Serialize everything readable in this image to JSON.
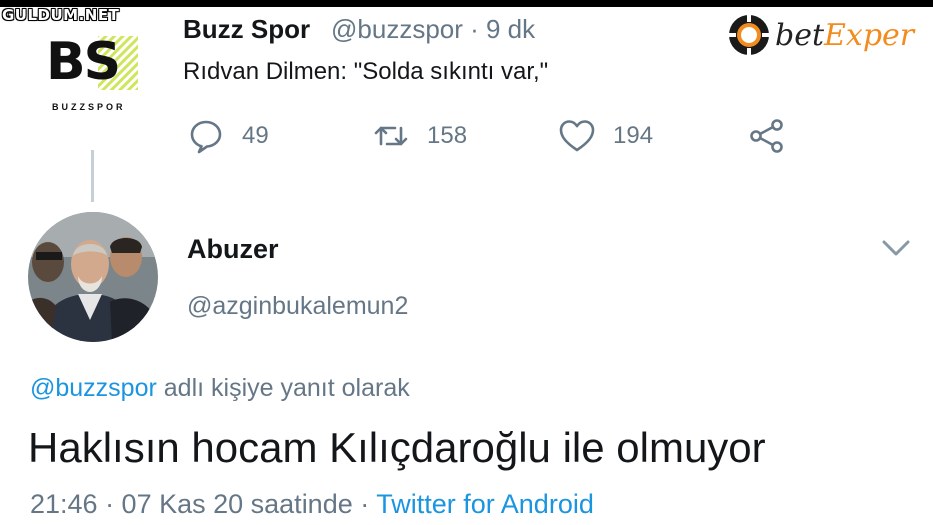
{
  "watermark": {
    "text": "GULDUM.NET"
  },
  "parent_tweet": {
    "avatar_logo": {
      "letters": "BS",
      "subtitle": "BUZZSPOR"
    },
    "name": "Buzz Spor",
    "handle_time": "@buzzspor · 9 dk",
    "text": "Rıdvan Dilmen: \"Solda sıkıntı var,\"",
    "actions": {
      "reply_count": "49",
      "retweet_count": "158",
      "like_count": "194"
    }
  },
  "ad_logo": {
    "bet": "bet",
    "exper": "Exper"
  },
  "reply_tweet": {
    "name": "Abuzer",
    "handle": "@azginbukalemun2",
    "reply_to": {
      "mention": "@buzzspor",
      "suffix": " adlı kişiye yanıt olarak"
    },
    "text": "Haklısın hocam Kılıçdaroğlu ile olmuyor",
    "meta": {
      "datetime": "21:46 · 07 Kas 20 saatinde · ",
      "source": "Twitter for Android"
    }
  },
  "colors": {
    "text": "#14171a",
    "secondary": "#657786",
    "link": "#1b95e0",
    "brand_orange": "#f28c1e"
  },
  "icons": [
    "reply-icon",
    "retweet-icon",
    "like-icon",
    "share-icon",
    "chevron-down-icon",
    "poker-chip-icon"
  ]
}
